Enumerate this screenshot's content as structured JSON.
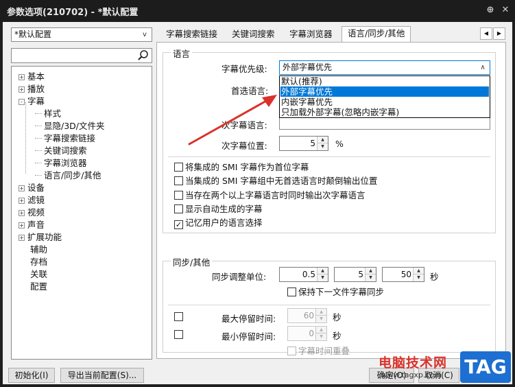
{
  "window": {
    "title": "参数选项(210702) - *默认配置",
    "pin_icon": "pin-icon",
    "close_icon": "close-icon"
  },
  "left": {
    "profile_select": "*默认配置",
    "search_placeholder": "",
    "tree": [
      {
        "label": "基本",
        "expander": "+",
        "level": 0
      },
      {
        "label": "播放",
        "expander": "+",
        "level": 0
      },
      {
        "label": "字幕",
        "expander": "-",
        "level": 0
      },
      {
        "label": "样式",
        "level": 1
      },
      {
        "label": "显隐/3D/文件夹",
        "level": 1
      },
      {
        "label": "字幕搜索链接",
        "level": 1
      },
      {
        "label": "关键词搜索",
        "level": 1
      },
      {
        "label": "字幕浏览器",
        "level": 1
      },
      {
        "label": "语言/同步/其他",
        "level": 1,
        "selected": true
      },
      {
        "label": "设备",
        "expander": "+",
        "level": 0
      },
      {
        "label": "滤镜",
        "expander": "+",
        "level": 0
      },
      {
        "label": "视频",
        "expander": "+",
        "level": 0
      },
      {
        "label": "声音",
        "expander": "+",
        "level": 0
      },
      {
        "label": "扩展功能",
        "expander": "+",
        "level": 0
      },
      {
        "label": "辅助",
        "level": 0
      },
      {
        "label": "存档",
        "level": 0
      },
      {
        "label": "关联",
        "level": 0
      },
      {
        "label": "配置",
        "level": 0
      }
    ]
  },
  "tabs": [
    {
      "label": "字幕搜索链接"
    },
    {
      "label": "关键词搜索"
    },
    {
      "label": "字幕浏览器"
    },
    {
      "label": "语言/同步/其他",
      "active": true
    }
  ],
  "tab_scroll": {
    "left": "◀",
    "right": "▶"
  },
  "language": {
    "group_title": "语言",
    "priority_label": "字幕优先级:",
    "priority_value": "外部字幕优先",
    "priority_options": [
      "默认(推荐)",
      "外部字幕优先",
      "内嵌字幕优先",
      "只加载外部字幕(忽略内嵌字幕)"
    ],
    "primary_label": "首选语言:",
    "secondary_label": "次字幕语言:",
    "secondary_pos_label": "次字幕位置:",
    "secondary_pos_value": "5",
    "secondary_pos_unit": "%",
    "checks": [
      {
        "label": "将集成的 SMI 字幕作为首位字幕",
        "checked": false
      },
      {
        "label": "当集成的 SMI 字幕组中无首选语言时颠倒输出位置",
        "checked": false
      },
      {
        "label": "当存在两个以上字幕语言时同时输出次字幕语言",
        "checked": false
      },
      {
        "label": "显示自动生成的字幕",
        "checked": false
      },
      {
        "label": "记忆用户的语言选择",
        "checked": true
      }
    ]
  },
  "sync": {
    "group_title": "同步/其他",
    "unit_label": "同步调整单位:",
    "unit_values": [
      "0.5",
      "5",
      "50"
    ],
    "unit_suffix": "秒",
    "keep_sync_label": "保持下一文件字幕同步",
    "max_label": "最大停留时间:",
    "max_value": "60",
    "max_unit": "秒",
    "min_label": "最小停留时间:",
    "min_value": "0",
    "min_unit": "秒",
    "overlap_label": "字幕时间重叠"
  },
  "footer": {
    "init_button": "初始化(I)",
    "export_button": "导出当前配置(S)...",
    "ok_button": "确定(O)",
    "cancel_button": "取消(C)"
  },
  "watermark": {
    "site_name": "电脑技术网",
    "site_url": "www.tagxp.com",
    "logo": "TAG"
  },
  "colors": {
    "accent": "#0078d7",
    "arrow": "#d9322b",
    "title_bg": "#1c1c1c"
  }
}
